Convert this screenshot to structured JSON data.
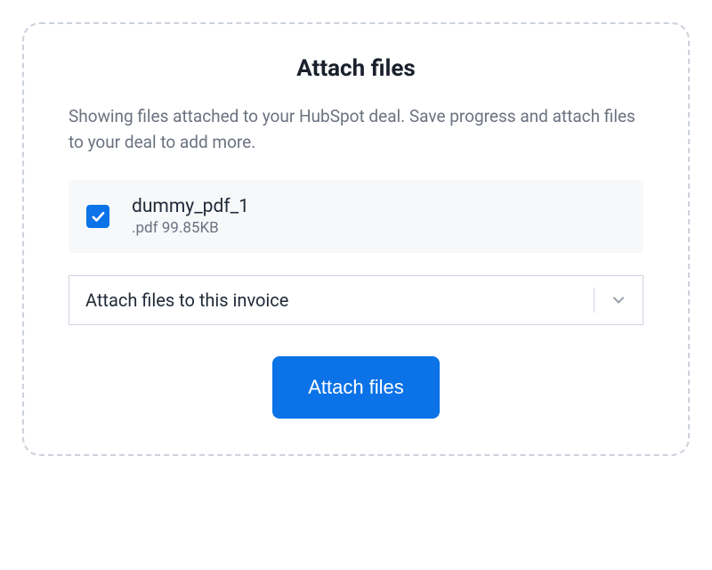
{
  "modal": {
    "title": "Attach files",
    "description": "Showing files attached to your HubSpot deal. Save progress and attach files to your deal to add more."
  },
  "files": [
    {
      "name": "dummy_pdf_1",
      "meta": ".pdf 99.85KB",
      "checked": true
    }
  ],
  "select": {
    "label": "Attach files to this invoice"
  },
  "actions": {
    "attach_label": "Attach files"
  },
  "colors": {
    "primary": "#0b72e7",
    "text_primary": "#1a202c",
    "text_secondary": "#6b7280",
    "border_dashed": "#cbd2dc",
    "row_bg": "#f6f8fa"
  }
}
